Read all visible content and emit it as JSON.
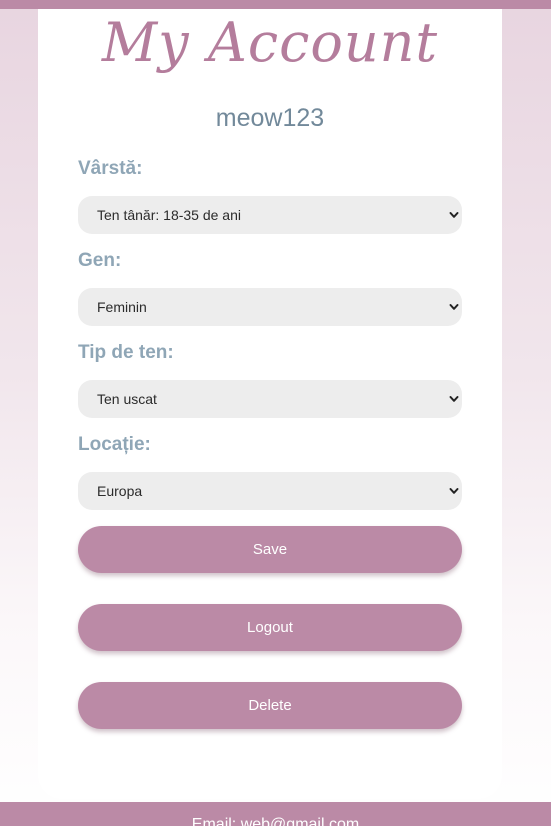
{
  "header": {
    "title": "My Account",
    "username": "meow123"
  },
  "form": {
    "age": {
      "label": "Vârstă:",
      "selected": "Ten tânăr: 18-35 de ani"
    },
    "gender": {
      "label": "Gen:",
      "selected": "Feminin"
    },
    "skin_type": {
      "label": "Tip de ten:",
      "selected": "Ten uscat"
    },
    "location": {
      "label": "Locație:",
      "selected": "Europa"
    }
  },
  "actions": {
    "save_label": "Save",
    "logout_label": "Logout",
    "delete_label": "Delete"
  },
  "footer": {
    "contact": "Email: web@gmail.com"
  },
  "colors": {
    "accent": "#bb8aa6",
    "title": "#b47d9c",
    "label": "#8fa6b6",
    "field_bg": "#ededed"
  },
  "icons": {
    "dropdown": "chevron-down-icon"
  }
}
